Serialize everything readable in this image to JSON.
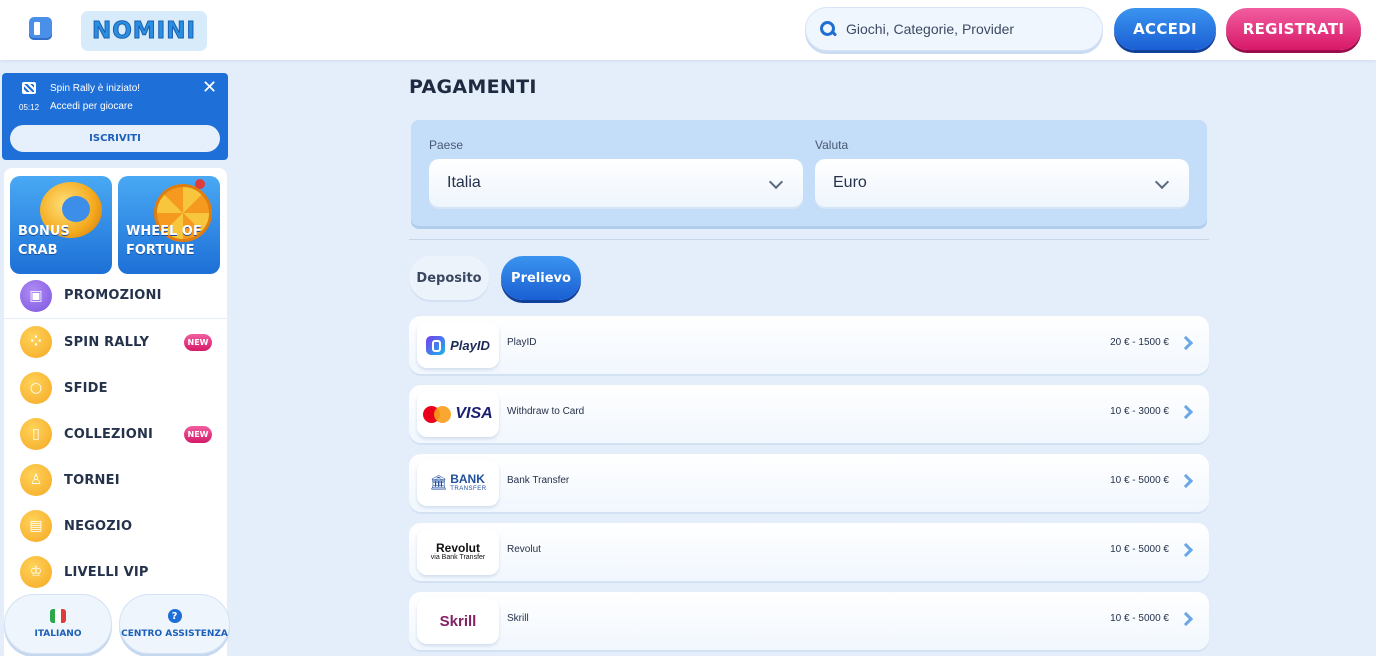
{
  "header": {
    "logo_text": "NOMINI",
    "search_placeholder": "Giochi, Categorie, Provider",
    "login_label": "ACCEDI",
    "register_label": "REGISTRATI"
  },
  "promo": {
    "title": "Spin Rally è iniziato!",
    "subtitle": "Accedi per giocare",
    "timer": "05:12",
    "button_label": "ISCRIVITI"
  },
  "tiles": [
    {
      "label_line1": "BONUS CRAB",
      "label_line2": ""
    },
    {
      "label_line1": "WHEEL OF",
      "label_line2": "FORTUNE"
    }
  ],
  "nav": {
    "items": [
      {
        "label": "PROMOZIONI",
        "icon": "gift-icon",
        "badge": ""
      },
      {
        "label": "SPIN RALLY",
        "icon": "dice-icon",
        "badge": "NEW"
      },
      {
        "label": "SFIDE",
        "icon": "medal-icon",
        "badge": ""
      },
      {
        "label": "COLLEZIONI",
        "icon": "cards-icon",
        "badge": "NEW"
      },
      {
        "label": "TORNEI",
        "icon": "trophy-icon",
        "badge": ""
      },
      {
        "label": "NEGOZIO",
        "icon": "shop-icon",
        "badge": ""
      },
      {
        "label": "LIVELLI VIP",
        "icon": "crown-icon",
        "badge": ""
      }
    ]
  },
  "footer": {
    "language_label": "ITALIANO",
    "help_label": "CENTRO ASSISTENZA"
  },
  "main": {
    "title": "PAGAMENTI",
    "country_label": "Paese",
    "country_value": "Italia",
    "currency_label": "Valuta",
    "currency_value": "Euro",
    "tabs": {
      "deposit": "Deposito",
      "withdraw": "Prelievo"
    },
    "methods": [
      {
        "logo_text": "PlayID",
        "name": "PlayID",
        "range": "20 € - 1500 €"
      },
      {
        "logo_text": "VISA",
        "name": "Withdraw to Card",
        "range": "10 € - 3000 €"
      },
      {
        "logo_text": "BANK",
        "logo_sub": "TRANSFER",
        "name": "Bank Transfer",
        "range": "10 € - 5000 €"
      },
      {
        "logo_text": "Revolut",
        "logo_sub": "via Bank Transfer",
        "name": "Revolut",
        "range": "10 € - 5000 €"
      },
      {
        "logo_text": "Skrill",
        "name": "Skrill",
        "range": "10 € - 5000 €"
      }
    ]
  }
}
